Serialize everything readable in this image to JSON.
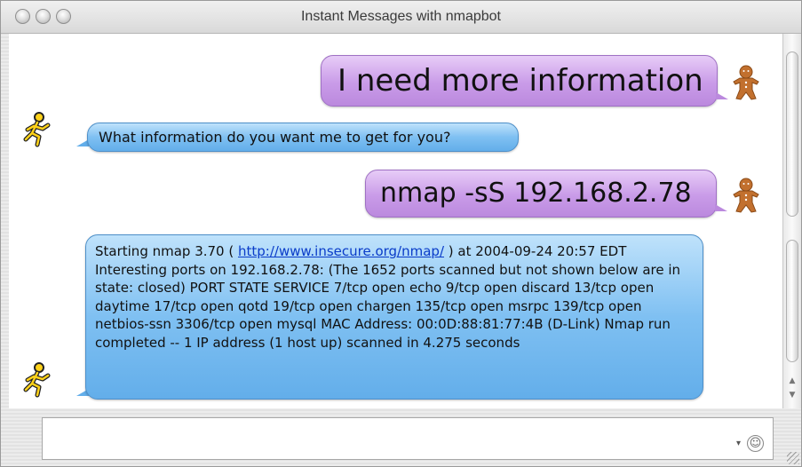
{
  "window": {
    "title": "Instant Messages with nmapbot"
  },
  "messages": [
    {
      "direction": "outgoing",
      "avatar": "gingerbread-man-icon",
      "text": "I need more information"
    },
    {
      "direction": "incoming",
      "avatar": "aim-running-man-icon",
      "text": "What information do you want me to get for you?"
    },
    {
      "direction": "outgoing",
      "avatar": "gingerbread-man-icon",
      "text": "nmap -sS 192.168.2.78"
    },
    {
      "direction": "incoming",
      "avatar": "aim-running-man-icon",
      "text_before": "Starting nmap 3.70 ( ",
      "link": "http://www.insecure.org/nmap/",
      "text_after": " ) at 2004-09-24 20:57 EDT Interesting ports on 192.168.2.78: (The 1652 ports scanned but not shown below are in state: closed) PORT STATE SERVICE 7/tcp open echo 9/tcp open discard 13/tcp open daytime 17/tcp open qotd 19/tcp open chargen 135/tcp open msrpc 139/tcp open netbios-ssn 3306/tcp open mysql MAC Address: 00:0D:88:81:77:4B (D-Link) Nmap run completed -- 1 IP address (1 host up) scanned in 4.275 seconds"
    }
  ],
  "input": {
    "value": ""
  },
  "colors": {
    "outgoing_bubble": "#c99be8",
    "incoming_bubble": "#7fc0f2",
    "link": "#0a3cc9"
  }
}
